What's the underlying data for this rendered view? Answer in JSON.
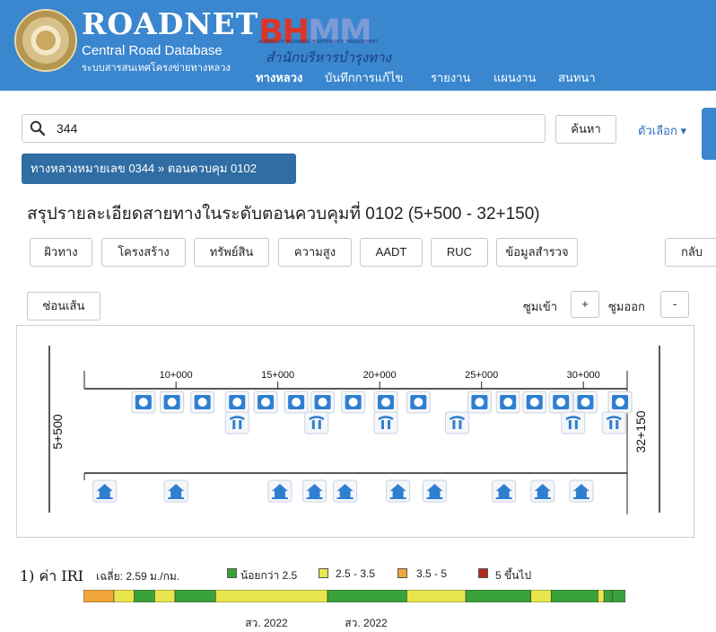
{
  "header": {
    "brand_title": "ROADNET",
    "brand_subtitle": "Central Road Database",
    "brand_subtitle_thai": "ระบบสารสนเทศโครงข่ายทางหลวง",
    "bhmm_logo": "BHMM",
    "bhmm_small": "BUREAU OF HIGHWAYS MAINTENANCE MANAGEMENT",
    "bhmm_thai": "สำนักบริหารบำรุงทาง",
    "nav": [
      {
        "label": "ทางหลวง",
        "active": true
      },
      {
        "label": "บันทึกการแก้ไข",
        "active": false
      },
      {
        "label": "รายงาน",
        "active": false
      },
      {
        "label": "แผนงาน",
        "active": false
      },
      {
        "label": "สนทนา",
        "active": false
      }
    ],
    "bg_color": "#3a86cf"
  },
  "search": {
    "value": "344",
    "button_label": "ค้นหา",
    "options_label": "ตัวเลือก ▾"
  },
  "breadcrumb": "ทางหลวงหมายเลข 0344 » ตอนควบคุม 0102",
  "page_title": "สรุปรายละเอียดสายทางในระดับตอนควบคุมที่ 0102 (5+500 - 32+150)",
  "tabs": [
    "ผิวทาง",
    "โครงสร้าง",
    "ทรัพย์สิน",
    "ความสูง",
    "AADT",
    "RUC",
    "ข้อมูลสำรวจ"
  ],
  "back_label": "กลับ",
  "hide_lines_label": "ซ่อนเส้น",
  "zoom": {
    "zoom_in_label": "ซูมเข้า",
    "zoom_in_btn": "+",
    "zoom_out_label": "ซูมออก",
    "zoom_out_btn": "-"
  },
  "diagram": {
    "start_label": "5+500",
    "end_label": "32+150",
    "km_start": 5.5,
    "km_end": 32.15,
    "ticks": [
      {
        "km": 10,
        "label": "10+000"
      },
      {
        "km": 15,
        "label": "15+000"
      },
      {
        "km": 20,
        "label": "20+000"
      },
      {
        "km": 25,
        "label": "25+000"
      },
      {
        "km": 30,
        "label": "30+000"
      }
    ],
    "circle_icons_km": [
      8.4,
      9.8,
      11.3,
      13.0,
      14.4,
      15.9,
      17.2,
      18.7,
      20.3,
      21.9,
      24.9,
      26.3,
      27.6,
      28.9,
      30.1,
      31.8
    ],
    "bridge_icons_km": [
      13.0,
      16.9,
      20.3,
      23.8,
      29.5,
      31.5
    ],
    "house_icons_km": [
      6.5,
      10.0,
      15.1,
      16.8,
      18.3,
      20.9,
      22.7,
      26.1,
      28.0,
      29.9
    ],
    "icon_color": "#2f7fd0"
  },
  "iri": {
    "title": "1) ค่า IRI",
    "average": "เฉลี่ย: 2.59 ม./กม.",
    "legend": [
      {
        "label": "น้อยกว่า 2.5",
        "color": "#3aa23a"
      },
      {
        "label": "2.5 - 3.5",
        "color": "#e8e64c"
      },
      {
        "label": "3.5 - 5",
        "color": "#f0a63a"
      },
      {
        "label": "5 ขึ้นไป",
        "color": "#b32a22"
      }
    ],
    "segments": [
      {
        "from": 5.5,
        "to": 7.0,
        "level": 2
      },
      {
        "from": 7.0,
        "to": 8.0,
        "level": 1
      },
      {
        "from": 8.0,
        "to": 9.0,
        "level": 0
      },
      {
        "from": 9.0,
        "to": 10.0,
        "level": 1
      },
      {
        "from": 10.0,
        "to": 12.0,
        "level": 0
      },
      {
        "from": 12.0,
        "to": 17.5,
        "level": 1
      },
      {
        "from": 17.5,
        "to": 21.4,
        "level": 0
      },
      {
        "from": 21.4,
        "to": 24.3,
        "level": 1
      },
      {
        "from": 24.3,
        "to": 27.5,
        "level": 0
      },
      {
        "from": 27.5,
        "to": 28.5,
        "level": 1
      },
      {
        "from": 28.5,
        "to": 30.8,
        "level": 0
      },
      {
        "from": 30.8,
        "to": 31.1,
        "level": 1
      },
      {
        "from": 31.1,
        "to": 31.5,
        "level": 0
      },
      {
        "from": 31.5,
        "to": 32.15,
        "level": 0
      }
    ],
    "years": [
      {
        "km": 14.6,
        "label": "สว. 2022"
      },
      {
        "km": 19.5,
        "label": "สว. 2022"
      }
    ]
  }
}
